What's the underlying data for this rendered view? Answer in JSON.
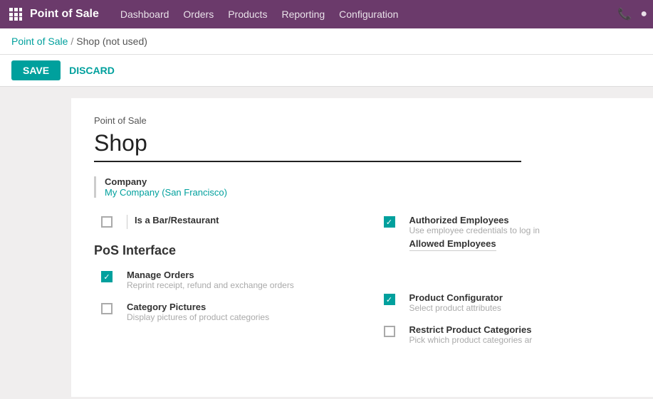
{
  "topnav": {
    "app_title": "Point of Sale",
    "menu_items": [
      "Dashboard",
      "Orders",
      "Products",
      "Reporting",
      "Configuration"
    ]
  },
  "breadcrumb": {
    "parent": "Point of Sale",
    "separator": "/",
    "current": "Shop (not used)"
  },
  "toolbar": {
    "save_label": "SAVE",
    "discard_label": "DISCARD"
  },
  "form": {
    "section_label": "Point of Sale",
    "shop_name": "Shop",
    "company": {
      "label": "Company",
      "value": "My Company (San Francisco)"
    },
    "is_bar_restaurant": {
      "label": "Is a Bar/Restaurant",
      "checked": false
    },
    "authorized_employees": {
      "label": "Authorized Employees",
      "desc": "Use employee credentials to log in",
      "sub_label": "Allowed Employees",
      "checked": true
    },
    "pos_interface_header": "PoS Interface",
    "manage_orders": {
      "label": "Manage Orders",
      "desc": "Reprint receipt, refund and exchange orders",
      "checked": true
    },
    "product_configurator": {
      "label": "Product Configurator",
      "desc": "Select product attributes",
      "checked": true
    },
    "category_pictures": {
      "label": "Category Pictures",
      "desc": "Display pictures of product categories",
      "checked": false
    },
    "restrict_product_categories": {
      "label": "Restrict Product Categories",
      "desc": "Pick which product categories ar",
      "checked": false
    }
  }
}
